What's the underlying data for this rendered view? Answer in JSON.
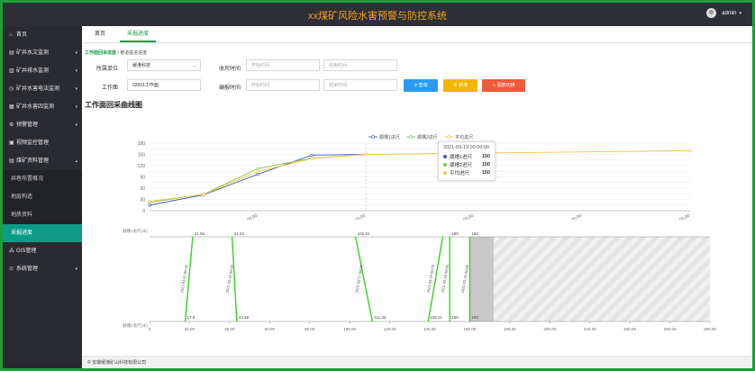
{
  "app": {
    "title": "xx煤矿风险水害预警与防控系统"
  },
  "user": {
    "name": "admin",
    "caret": "▾"
  },
  "sidebar": {
    "items": [
      {
        "icon": "⌂",
        "label": "首页",
        "chevron": ""
      },
      {
        "icon": "▤",
        "label": "矿井水文监测",
        "chevron": "▾"
      },
      {
        "icon": "▥",
        "label": "矿井排水监测",
        "chevron": "▾"
      },
      {
        "icon": "◷",
        "label": "矿井水害电法监测",
        "chevron": "▾"
      },
      {
        "icon": "▦",
        "label": "矿井水害四监测",
        "chevron": "▾"
      },
      {
        "icon": "⚙",
        "label": "预警管理",
        "chevron": "▾"
      },
      {
        "icon": "▣",
        "label": "视频监控管理",
        "chevron": ""
      },
      {
        "icon": "▤",
        "label": "煤矿资料管理",
        "chevron": "▴"
      },
      {
        "icon": "",
        "label": "井巷布置概况",
        "chevron": ""
      },
      {
        "icon": "",
        "label": "地层构造",
        "chevron": ""
      },
      {
        "icon": "",
        "label": "地质资料",
        "chevron": ""
      },
      {
        "icon": "",
        "label": "采掘进度",
        "chevron": ""
      },
      {
        "icon": "⁂",
        "label": "GIS管理",
        "chevron": ""
      },
      {
        "icon": "⊙",
        "label": "系统管理",
        "chevron": "▾"
      }
    ]
  },
  "tabs": [
    {
      "label": "首页"
    },
    {
      "label": "采掘进度"
    }
  ],
  "breadcrumb": {
    "current": "工作面回采进度",
    "sep": "|",
    "other": "巷道掘进进度"
  },
  "form": {
    "unit_label": "所属单位",
    "unit_value": "缓港科技",
    "unit_caret": "⌄",
    "recv_time_label": "收尺时间",
    "recv_start_ph": "开始时间",
    "recv_end_ph": "结束时间",
    "face_label": "工作面",
    "face_value": "02001工作面",
    "edit_time_label": "编报时间",
    "edit_start_ph": "开始时间",
    "edit_end_ph": "结束时间",
    "btn_query": "查询",
    "btn_add": "新增",
    "btn_switch": "图表切换"
  },
  "section": {
    "title": "工作面回采曲线图"
  },
  "chart_data": [
    {
      "type": "line",
      "x": [
        "2021-03-15",
        "2021-03-16",
        "2021-03-17",
        "2021-03-18",
        "2021-03-19",
        "2021-03-25"
      ],
      "series": [
        {
          "name": "顺槽1进尺",
          "values": [
            15,
            42,
            97,
            148,
            150,
            null
          ]
        },
        {
          "name": "顺槽2进尺",
          "values": [
            22,
            44,
            112,
            140,
            150,
            null
          ]
        },
        {
          "name": "平均进尺",
          "values": [
            25,
            43,
            104,
            139,
            150,
            160
          ]
        }
      ],
      "ylim": [
        0,
        180
      ],
      "y_ticks": [
        0,
        15,
        30,
        45,
        60,
        75,
        90,
        105,
        120,
        135,
        150,
        165,
        180
      ],
      "y_tick_labels": [
        "0",
        "",
        "30",
        "",
        "60",
        "",
        "90",
        "",
        "120",
        "",
        "150",
        "",
        "180"
      ],
      "x_tick_labels": [
        "2021-03-17 00:00:00",
        "2021-03-19 00:00:00",
        "2021-03-21 00:00:00",
        "2021-03-23 00:00:00",
        "2021-03-25 00:00:00"
      ],
      "legend": "top-center",
      "tooltip": {
        "title": "2021-03-19 00:00:00",
        "rows": [
          {
            "name": "顺槽1进尺",
            "value": "150"
          },
          {
            "name": "顺槽2进尺",
            "value": "150"
          },
          {
            "name": "平均进尺",
            "value": "150"
          }
        ]
      }
    },
    {
      "type": "scatter",
      "top_axis_label": "顺槽1进尺(米)",
      "bottom_axis_label": "顺槽2进尺(米)",
      "xlim": [
        0,
        280
      ],
      "x_ticks": [
        "0",
        "20.00",
        "40.00",
        "60.00",
        "80.00",
        "100.00",
        "120.00",
        "140.00",
        "160.00",
        "180.00",
        "200.00",
        "220.00",
        "240.00",
        "260.00",
        "280.00"
      ],
      "segments": [
        {
          "top": 21.56,
          "bottom": 17.8,
          "top_label": "21.56",
          "bottom_label": "17.8",
          "date": "2021-03-15 00:00"
        },
        {
          "top": 41.24,
          "bottom": 43.59,
          "top_label": "41.24",
          "bottom_label": "43.59",
          "date": "2021-03-16 00:00"
        },
        {
          "top": 102.91,
          "bottom": 111.33,
          "top_label": "102.91",
          "bottom_label": "111.33",
          "date": "2021-03-17 00:00"
        },
        {
          "top": 146.5,
          "bottom": 139.21,
          "top_label": "",
          "bottom_label": "139.21",
          "date": "2021-03-18 00:00"
        },
        {
          "top": 150,
          "bottom": 150,
          "top_label": "150",
          "bottom_label": "150",
          "date": "2021-03-19 00:00"
        },
        {
          "top": 160,
          "bottom": 160,
          "top_label": "160",
          "bottom_label": "160",
          "date": "2021-03-20 00:00"
        }
      ],
      "mined_region": [
        160,
        172
      ],
      "unmined_region": [
        172,
        280
      ],
      "colors": {
        "segment": "#35d11f",
        "mined": "#c9c9c9",
        "unmined": "#ededed"
      }
    }
  ],
  "series_colors": [
    "#3b5bb8",
    "#8ac148",
    "#f0c246"
  ],
  "footer": {
    "text": "© 安徽缓港矿山科技有限公司"
  }
}
